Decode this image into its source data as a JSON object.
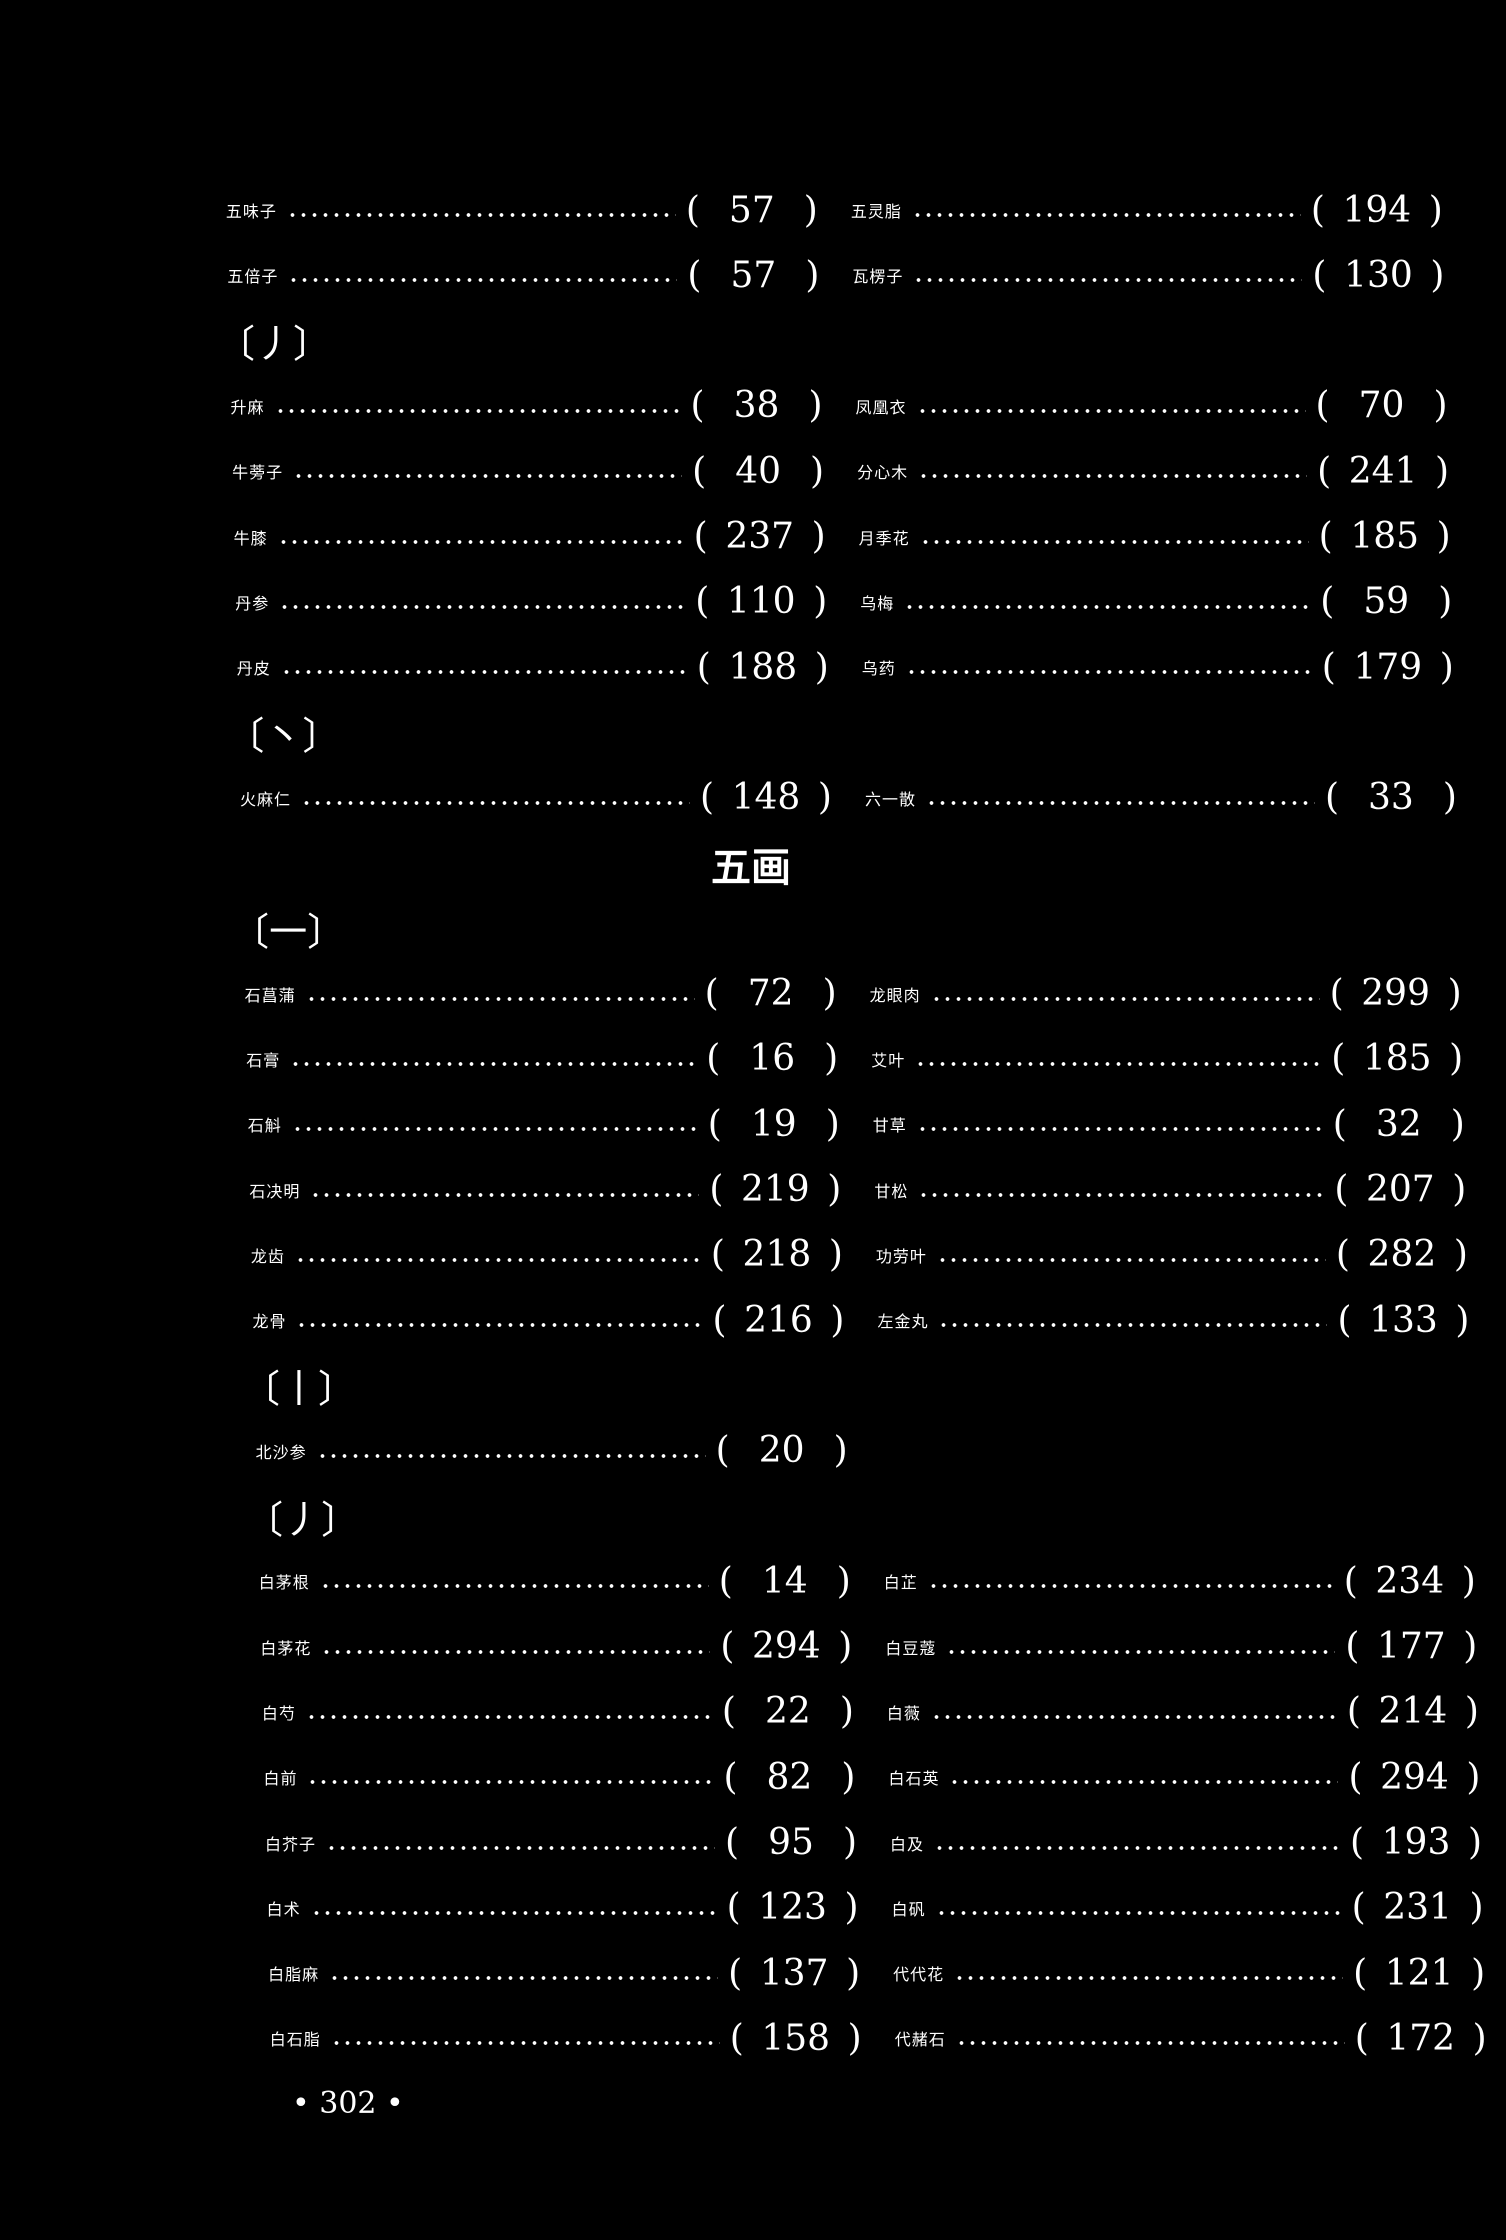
{
  "sections": [
    {
      "stroke": "",
      "rows": [
        {
          "left": {
            "name": "五味子",
            "page": "57"
          },
          "right": {
            "name": "五灵脂",
            "page": "194"
          }
        },
        {
          "left": {
            "name": "五倍子",
            "page": "57"
          },
          "right": {
            "name": "瓦楞子",
            "page": "130"
          }
        }
      ]
    },
    {
      "stroke": "〔丿〕",
      "rows": [
        {
          "left": {
            "name": "升麻",
            "page": "38"
          },
          "right": {
            "name": "凤凰衣",
            "page": "70"
          }
        },
        {
          "left": {
            "name": "牛蒡子",
            "page": "40"
          },
          "right": {
            "name": "分心木",
            "page": "241"
          }
        },
        {
          "left": {
            "name": "牛膝",
            "page": "237"
          },
          "right": {
            "name": "月季花",
            "page": "185"
          }
        },
        {
          "left": {
            "name": "丹参",
            "page": "110"
          },
          "right": {
            "name": "乌梅",
            "page": "59"
          }
        },
        {
          "left": {
            "name": "丹皮",
            "page": "188"
          },
          "right": {
            "name": "乌药",
            "page": "179"
          }
        }
      ]
    },
    {
      "stroke": "〔丶〕",
      "rows": [
        {
          "left": {
            "name": "火麻仁",
            "page": "148"
          },
          "right": {
            "name": "六一散",
            "page": "33"
          }
        }
      ]
    }
  ],
  "heading": "五画",
  "sections2": [
    {
      "stroke": "〔一〕",
      "rows": [
        {
          "left": {
            "name": "石菖蒲",
            "page": "72"
          },
          "right": {
            "name": "龙眼肉",
            "page": "299"
          }
        },
        {
          "left": {
            "name": "石膏",
            "page": "16"
          },
          "right": {
            "name": "艾叶",
            "page": "185"
          }
        },
        {
          "left": {
            "name": "石斛",
            "page": "19"
          },
          "right": {
            "name": "甘草",
            "page": "32"
          }
        },
        {
          "left": {
            "name": "石决明",
            "page": "219"
          },
          "right": {
            "name": "甘松",
            "page": "207"
          }
        },
        {
          "left": {
            "name": "龙齿",
            "page": "218"
          },
          "right": {
            "name": "功劳叶",
            "page": "282"
          }
        },
        {
          "left": {
            "name": "龙骨",
            "page": "216"
          },
          "right": {
            "name": "左金丸",
            "page": "133"
          }
        }
      ]
    },
    {
      "stroke": "〔丨〕",
      "rows": [
        {
          "left": {
            "name": "北沙参",
            "page": "20"
          },
          "right": null
        }
      ]
    },
    {
      "stroke": "〔丿〕",
      "rows": [
        {
          "left": {
            "name": "白茅根",
            "page": "14"
          },
          "right": {
            "name": "白芷",
            "page": "234"
          }
        },
        {
          "left": {
            "name": "白茅花",
            "page": "294"
          },
          "right": {
            "name": "白豆蔻",
            "page": "177"
          }
        },
        {
          "left": {
            "name": "白芍",
            "page": "22"
          },
          "right": {
            "name": "白薇",
            "page": "214"
          }
        },
        {
          "left": {
            "name": "白前",
            "page": "82"
          },
          "right": {
            "name": "白石英",
            "page": "294"
          }
        },
        {
          "left": {
            "name": "白芥子",
            "page": "95"
          },
          "right": {
            "name": "白及",
            "page": "193"
          }
        },
        {
          "left": {
            "name": "白术",
            "page": "123"
          },
          "right": {
            "name": "白矾",
            "page": "231"
          }
        },
        {
          "left": {
            "name": "白脂麻",
            "page": "137"
          },
          "right": {
            "name": "代代花",
            "page": "121"
          }
        },
        {
          "left": {
            "name": "白石脂",
            "page": "158"
          },
          "right": {
            "name": "代赭石",
            "page": "172"
          }
        }
      ]
    }
  ],
  "footer": "• 302 •"
}
